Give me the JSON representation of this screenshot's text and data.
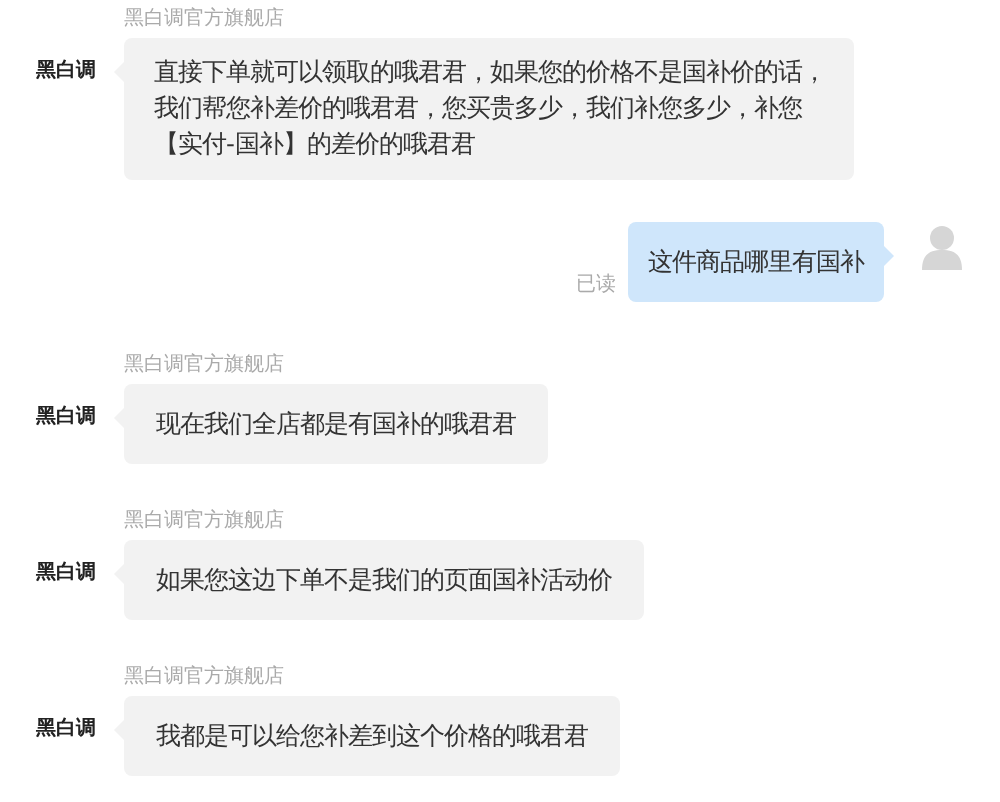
{
  "messages": [
    {
      "kind": "incoming",
      "sender": "黑白调官方旗舰店",
      "avatar_label": "黑白调",
      "text": "直接下单就可以领取的哦君君，如果您的价格不是国补价的话，我们帮您补差价的哦君君，您买贵多少，我们补您多少，补您【实付-国补】的差价的哦君君"
    },
    {
      "kind": "outgoing",
      "text": "这件商品哪里有国补",
      "status": "已读"
    },
    {
      "kind": "incoming",
      "sender": "黑白调官方旗舰店",
      "avatar_label": "黑白调",
      "text": "现在我们全店都是有国补的哦君君"
    },
    {
      "kind": "incoming",
      "sender": "黑白调官方旗舰店",
      "avatar_label": "黑白调",
      "text": "如果您这边下单不是我们的页面国补活动价"
    },
    {
      "kind": "incoming",
      "sender": "黑白调官方旗舰店",
      "avatar_label": "黑白调",
      "text": "我都是可以给您补差到这个价格的哦君君"
    }
  ]
}
